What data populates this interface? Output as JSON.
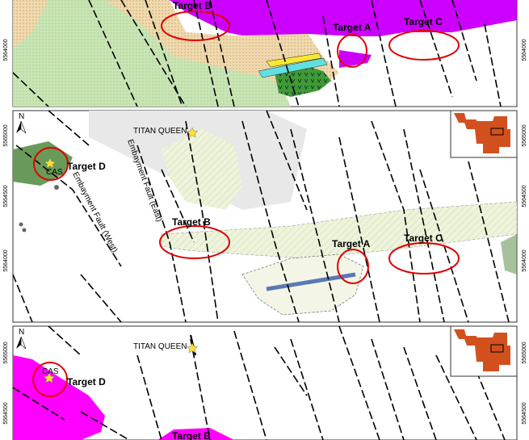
{
  "panels": [
    {
      "id": "top",
      "targets": [
        {
          "label": "Target B"
        },
        {
          "label": "Target A"
        },
        {
          "label": "Target C"
        }
      ],
      "coords_left": [
        "5564000"
      ],
      "coords_right": [
        "5564000"
      ]
    },
    {
      "id": "middle",
      "targets": [
        {
          "label": "Target D"
        },
        {
          "label": "Target B"
        },
        {
          "label": "Target A"
        },
        {
          "label": "Target C"
        }
      ],
      "places": [
        "TITAN QUEEN",
        "CAS"
      ],
      "faults": [
        "Embayment Fault (East)",
        "Embayment Fault (West)"
      ],
      "coords_left": [
        "5565000",
        "5564500",
        "5564000"
      ],
      "coords_right": [
        "5565000",
        "5564500",
        "5564000"
      ],
      "north": "N"
    },
    {
      "id": "bottom",
      "targets": [
        {
          "label": "Target D"
        },
        {
          "label": "Target B"
        }
      ],
      "places": [
        "TITAN QUEEN",
        "CAS"
      ],
      "coords_left": [
        "5565000",
        "5564500"
      ],
      "coords_right": [
        "5565000",
        "5564500"
      ],
      "north": "N"
    }
  ],
  "colors": {
    "geology_green": "#c8e6b4",
    "geology_tan": "#f2d9ac",
    "magenta_unit": "#cc00ff",
    "pink_unit": "#ff00ff",
    "target_ring": "#e00000",
    "inset_fill": "#d2501e",
    "star": "#ffe033",
    "grey_zone": "#e8e8e8",
    "dyke_blue": "#5a78b4"
  }
}
